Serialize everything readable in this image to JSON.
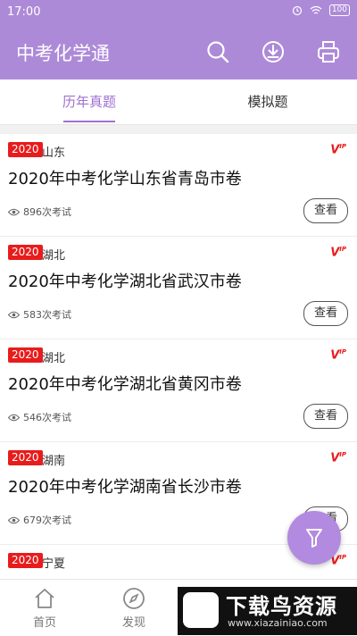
{
  "status": {
    "time": "17:00",
    "battery": "100"
  },
  "app": {
    "title": "中考化学通"
  },
  "tabs": [
    {
      "label": "历年真题"
    },
    {
      "label": "模拟题"
    }
  ],
  "papers": [
    {
      "year": "2020",
      "region": "山东",
      "title": "2020年中考化学山东省青岛市卷",
      "views": "896次考试",
      "button": "查看"
    },
    {
      "year": "2020",
      "region": "湖北",
      "title": "2020年中考化学湖北省武汉市卷",
      "views": "583次考试",
      "button": "查看"
    },
    {
      "year": "2020",
      "region": "湖北",
      "title": "2020年中考化学湖北省黄冈市卷",
      "views": "546次考试",
      "button": "查看"
    },
    {
      "year": "2020",
      "region": "湖南",
      "title": "2020年中考化学湖南省长沙市卷",
      "views": "679次考试",
      "button": "查看"
    },
    {
      "year": "2020",
      "region": "宁夏"
    }
  ],
  "bottom_nav": [
    {
      "label": "首页"
    },
    {
      "label": "发现"
    }
  ],
  "watermark": {
    "title": "下载鸟资源",
    "url": "www.xiazainiao.com"
  },
  "colors": {
    "primary": "#ad8ad8",
    "accent": "#a070d0",
    "badge": "#e81c1c"
  }
}
